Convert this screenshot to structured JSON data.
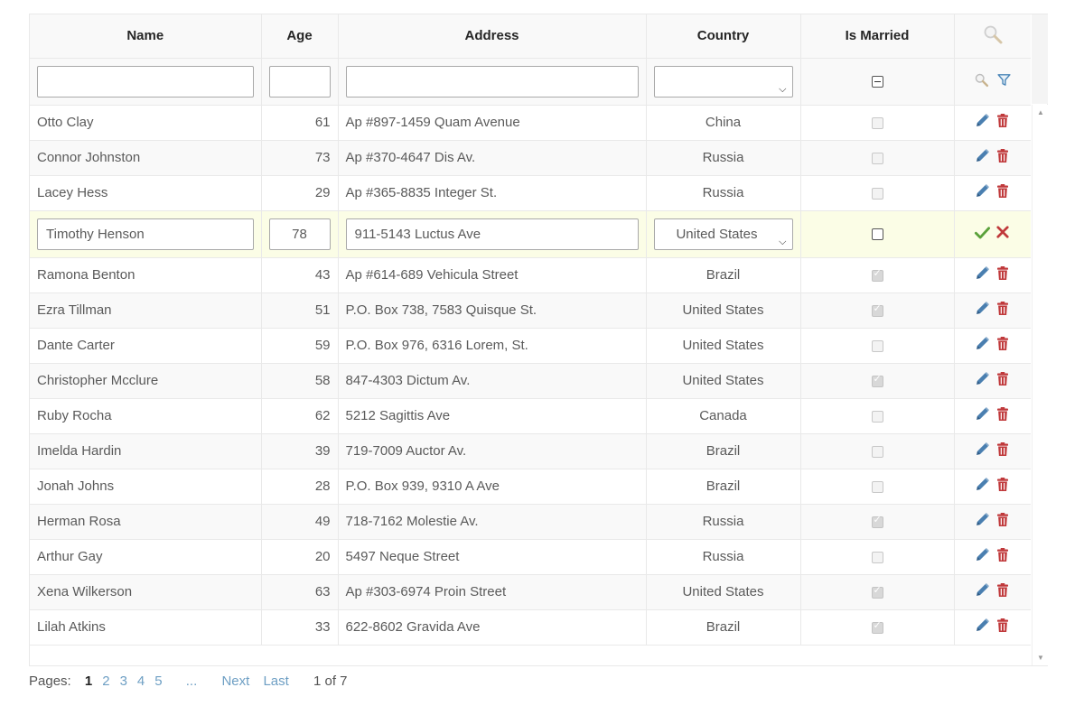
{
  "columns": {
    "name": "Name",
    "age": "Age",
    "address": "Address",
    "country": "Country",
    "married": "Is Married"
  },
  "filter": {
    "name": "",
    "age": "",
    "address": "",
    "country": ""
  },
  "rows": [
    {
      "name": "Otto Clay",
      "age": "61",
      "address": "Ap #897-1459 Quam Avenue",
      "country": "China",
      "married": false
    },
    {
      "name": "Connor Johnston",
      "age": "73",
      "address": "Ap #370-4647 Dis Av.",
      "country": "Russia",
      "married": false
    },
    {
      "name": "Lacey Hess",
      "age": "29",
      "address": "Ap #365-8835 Integer St.",
      "country": "Russia",
      "married": false
    },
    {
      "name": "Ramona Benton",
      "age": "43",
      "address": "Ap #614-689 Vehicula Street",
      "country": "Brazil",
      "married": true
    },
    {
      "name": "Ezra Tillman",
      "age": "51",
      "address": "P.O. Box 738, 7583 Quisque St.",
      "country": "United States",
      "married": true
    },
    {
      "name": "Dante Carter",
      "age": "59",
      "address": "P.O. Box 976, 6316 Lorem, St.",
      "country": "United States",
      "married": false
    },
    {
      "name": "Christopher Mcclure",
      "age": "58",
      "address": "847-4303 Dictum Av.",
      "country": "United States",
      "married": true
    },
    {
      "name": "Ruby Rocha",
      "age": "62",
      "address": "5212 Sagittis Ave",
      "country": "Canada",
      "married": false
    },
    {
      "name": "Imelda Hardin",
      "age": "39",
      "address": "719-7009 Auctor Av.",
      "country": "Brazil",
      "married": false
    },
    {
      "name": "Jonah Johns",
      "age": "28",
      "address": "P.O. Box 939, 9310 A Ave",
      "country": "Brazil",
      "married": false
    },
    {
      "name": "Herman Rosa",
      "age": "49",
      "address": "718-7162 Molestie Av.",
      "country": "Russia",
      "married": true
    },
    {
      "name": "Arthur Gay",
      "age": "20",
      "address": "5497 Neque Street",
      "country": "Russia",
      "married": false
    },
    {
      "name": "Xena Wilkerson",
      "age": "63",
      "address": "Ap #303-6974 Proin Street",
      "country": "United States",
      "married": true
    },
    {
      "name": "Lilah Atkins",
      "age": "33",
      "address": "622-8602 Gravida Ave",
      "country": "Brazil",
      "married": true
    }
  ],
  "edit_row": {
    "insert_after": 3,
    "name": "Timothy Henson",
    "age": "78",
    "address": "911-5143 Luctus Ave",
    "country": "United States",
    "married": false
  },
  "pager": {
    "label": "Pages:",
    "pages": [
      "1",
      "2",
      "3",
      "4",
      "5"
    ],
    "current": "1",
    "ellipsis": "...",
    "next": "Next",
    "last": "Last",
    "info": "1 of 7"
  },
  "icons": {
    "search": "search-icon",
    "filter": "filter-icon",
    "edit": "pencil-icon",
    "delete": "trash-icon",
    "confirm": "check-icon",
    "cancel": "close-icon"
  },
  "colors": {
    "edit": "#4a7fb0",
    "delete": "#c0393b",
    "confirm": "#5aa13a",
    "cancel": "#c0393b",
    "link": "#6e9fc4",
    "edit_row_bg": "#fbfde6",
    "header_bg": "#f9f9f9"
  }
}
